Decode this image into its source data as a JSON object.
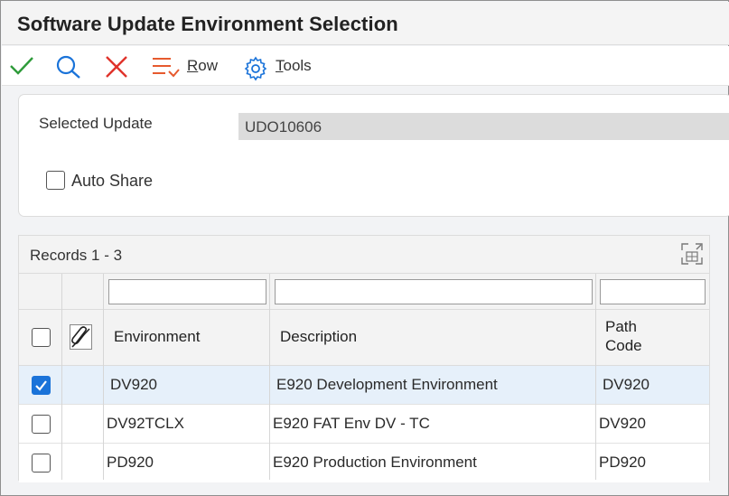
{
  "window": {
    "title": "Software Update Environment Selection"
  },
  "toolbar": {
    "ok_icon": "checkmark-icon",
    "find_icon": "search-icon",
    "cancel_icon": "close-icon",
    "row_icon": "row-menu-icon",
    "row_label_accel": "R",
    "row_label_rest": "ow",
    "tools_icon": "gear-icon",
    "tools_label_accel": "T",
    "tools_label_rest": "ools",
    "colors": {
      "ok": "#2e9b3a",
      "find": "#1a73d9",
      "cancel": "#e0332b",
      "row": "#e65a2e",
      "tools": "#1a73d9"
    }
  },
  "form": {
    "selected_update_label": "Selected Update",
    "selected_update_value": "UDO10606",
    "auto_share_label": "Auto Share",
    "auto_share_checked": false
  },
  "grid": {
    "records_label": "Records 1 - 3",
    "expand_icon": "expand-grid-icon",
    "attachment_icon": "attachment-clip-icon",
    "columns": {
      "environment": "Environment",
      "description": "Description",
      "path_code_line1": "Path",
      "path_code_line2": "Code"
    },
    "filters": {
      "environment": "",
      "description": "",
      "path_code": ""
    },
    "rows": [
      {
        "checked": true,
        "environment": "DV920",
        "description": "E920 Development Environment",
        "path_code": "DV920"
      },
      {
        "checked": false,
        "environment": "DV92TCLX",
        "description": "E920 FAT Env DV - TC",
        "path_code": "DV920"
      },
      {
        "checked": false,
        "environment": "PD920",
        "description": "E920 Production Environment",
        "path_code": "PD920"
      }
    ],
    "selected_row_color": "#e6f0fa",
    "accent": "#1a73d9"
  }
}
